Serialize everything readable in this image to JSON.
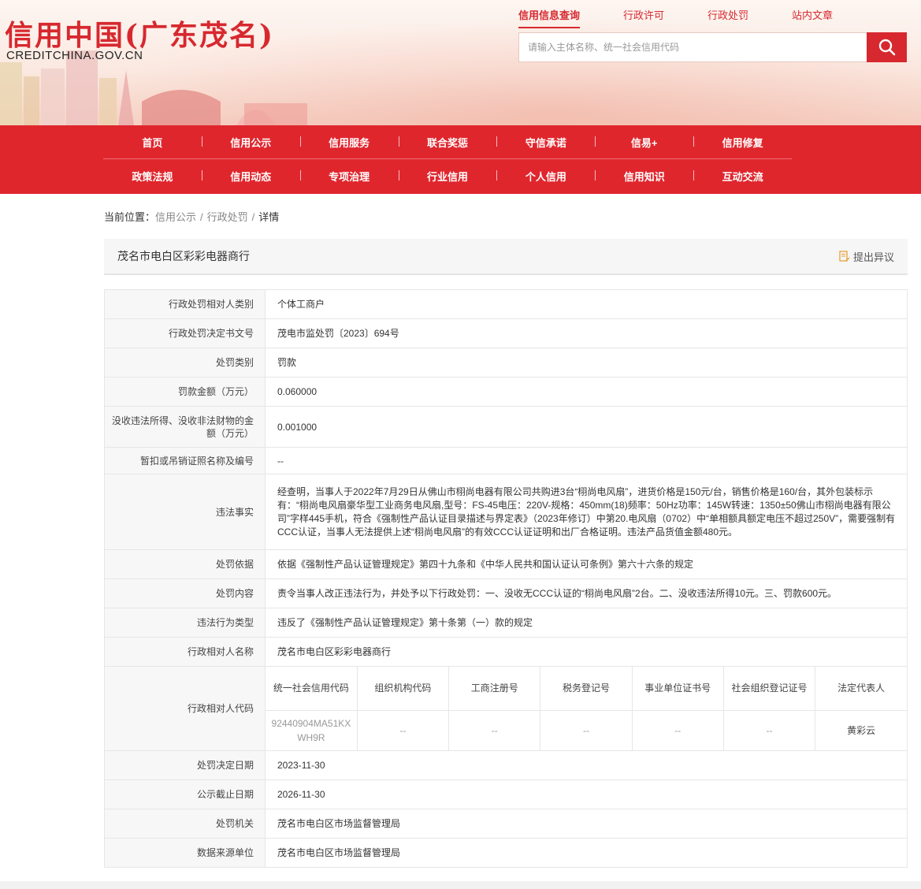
{
  "header": {
    "logo_title": "信用中国(广东茂名)",
    "logo_sub": "CREDITCHINA.GOV.CN",
    "top_links": [
      "信用信息查询",
      "行政许可",
      "行政处罚",
      "站内文章"
    ],
    "search_placeholder": "请输入主体名称、统一社会信用代码",
    "accent_color": "#d7282f"
  },
  "nav": {
    "row1": [
      "首页",
      "信用公示",
      "信用服务",
      "联合奖惩",
      "守信承诺",
      "信易+",
      "信用修复"
    ],
    "row2": [
      "政策法规",
      "信用动态",
      "专项治理",
      "行业信用",
      "个人信用",
      "信用知识",
      "互动交流"
    ]
  },
  "breadcrumb": {
    "prefix": "当前位置：",
    "items": [
      "信用公示",
      "行政处罚",
      "详情"
    ],
    "sep": "/"
  },
  "title": {
    "name": "茂名市电白区彩彩电器商行",
    "objection": "提出异议"
  },
  "rows": {
    "r1": {
      "label": "行政处罚相对人类别",
      "value": "个体工商户"
    },
    "r2": {
      "label": "行政处罚决定书文号",
      "value": "茂电市监处罚〔2023〕694号"
    },
    "r3": {
      "label": "处罚类别",
      "value": "罚款"
    },
    "r4": {
      "label": "罚款金额（万元）",
      "value": "0.060000"
    },
    "r5": {
      "label": "没收违法所得、没收非法财物的金额（万元）",
      "value": "0.001000"
    },
    "r6": {
      "label": "暂扣或吊销证照名称及编号",
      "value": "--"
    },
    "r7": {
      "label": "违法事实",
      "value": "经查明，当事人于2022年7月29日从佛山市栩尚电器有限公司共购进3台“栩尚电风扇”，进货价格是150元/台，销售价格是160/台，其外包装标示有：“栩尚电风扇豪华型工业商务电风扇,型号：FS-45电压：220V-规格：450mm(18)频率：50Hz功率：145W转速：1350±50佛山市栩尚电器有限公司”字样445手机，符合《强制性产品认证目录描述与界定表》（2023年修订）中第20.电风扇（0702）中“单相额具额定电压不超过250V”，需要强制有CCC认证，当事人无法提供上述“栩尚电风扇”的有效CCC认证证明和出厂合格证明。违法产品货值金额480元。"
    },
    "r8": {
      "label": "处罚依据",
      "value": "依据《强制性产品认证管理规定》第四十九条和《中华人民共和国认证认可条例》第六十六条的规定"
    },
    "r9": {
      "label": "处罚内容",
      "value": "责令当事人改正违法行为，并处予以下行政处罚：一、没收无CCC认证的“栩尚电风扇”2台。二、没收违法所得10元。三、罚款600元。"
    },
    "r10": {
      "label": "违法行为类型",
      "value": "违反了《强制性产品认证管理规定》第十条第（一）款的规定"
    },
    "r11": {
      "label": "行政相对人名称",
      "value": "茂名市电白区彩彩电器商行"
    },
    "r12": {
      "label": "行政相对人代码",
      "headers": {
        "h1": "统一社会信用代码",
        "h2": "组织机构代码",
        "h3": "工商注册号",
        "h4": "税务登记号",
        "h5": "事业单位证书号",
        "h6": "社会组织登记证号",
        "h7": "法定代表人"
      },
      "cells": {
        "c1": "92440904MA51KXWH9R",
        "c2": "--",
        "c3": "--",
        "c4": "--",
        "c5": "--",
        "c6": "--",
        "c7": "黄彩云"
      }
    },
    "r13": {
      "label": "处罚决定日期",
      "value": "2023-11-30"
    },
    "r14": {
      "label": "公示截止日期",
      "value": "2026-11-30"
    },
    "r15": {
      "label": "处罚机关",
      "value": "茂名市电白区市场监督管理局"
    },
    "r16": {
      "label": "数据来源单位",
      "value": "茂名市电白区市场监督管理局"
    }
  }
}
